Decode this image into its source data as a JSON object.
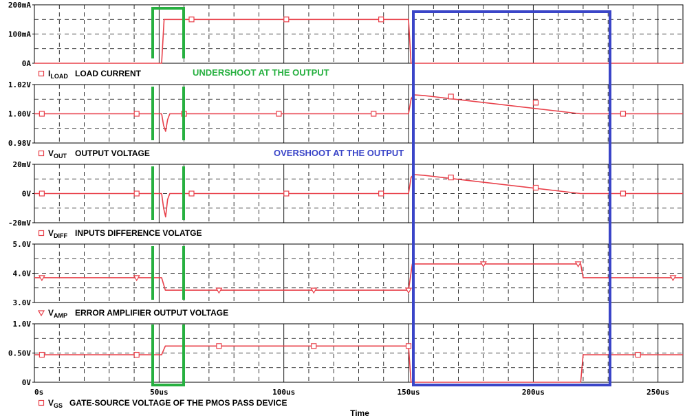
{
  "chart_data": {
    "type": "line",
    "xlabel": "Time",
    "x_ticks": [
      "0s",
      "50us",
      "100us",
      "150us",
      "200us",
      "250us"
    ],
    "xlim_us": [
      0,
      260
    ],
    "line_color": "#e8404a",
    "panels": [
      {
        "id": "iload",
        "signal": "I",
        "subscript": "LOAD",
        "description": "LOAD CURRENT",
        "marker": "square",
        "ylim": [
          0,
          0.2
        ],
        "y_ticks": [
          {
            "v": 0.2,
            "label": "200mA"
          },
          {
            "v": 0.1,
            "label": "100mA"
          },
          {
            "v": 0,
            "label": "0A"
          }
        ],
        "x": [
          0,
          51,
          52,
          150,
          151,
          260
        ],
        "y": [
          0,
          0,
          0.15,
          0.15,
          0,
          0
        ],
        "markers": [
          [
            63,
            0.15
          ],
          [
            101,
            0.15
          ],
          [
            139,
            0.15
          ]
        ]
      },
      {
        "id": "vout",
        "signal": "V",
        "subscript": "OUT",
        "description": "OUTPUT VOLTAGE",
        "marker": "square",
        "ylim": [
          0.98,
          1.02
        ],
        "y_ticks": [
          {
            "v": 1.02,
            "label": "1.02V"
          },
          {
            "v": 1.0,
            "label": "1.00V"
          },
          {
            "v": 0.98,
            "label": "0.98V"
          }
        ],
        "x": [
          0,
          51,
          51.8,
          52.6,
          53.4,
          54.3,
          150,
          151,
          152,
          156,
          219,
          260
        ],
        "y": [
          1.0,
          1.0,
          0.992,
          0.988,
          0.996,
          1.0,
          1.0,
          1.01,
          1.013,
          1.0125,
          1.0,
          1.0
        ],
        "markers": [
          [
            3,
            1.0
          ],
          [
            41,
            1.0
          ],
          [
            60,
            1.0
          ],
          [
            98,
            1.0
          ],
          [
            136,
            1.0
          ],
          [
            167,
            1.0118
          ],
          [
            201,
            1.0076
          ],
          [
            236,
            1.0
          ]
        ]
      },
      {
        "id": "vdiff",
        "signal": "V",
        "subscript": "DIFF",
        "description": "INPUTS DIFFERENCE VOLATGE",
        "marker": "square",
        "ylim": [
          -0.02,
          0.02
        ],
        "y_ticks": [
          {
            "v": 0.02,
            "label": "20mV"
          },
          {
            "v": 0,
            "label": "0V"
          },
          {
            "v": -0.02,
            "label": "-20mV"
          }
        ],
        "x": [
          0,
          51,
          51.8,
          52.6,
          53.4,
          54.3,
          150,
          151,
          152,
          156,
          219,
          260
        ],
        "y": [
          0,
          0,
          -0.01,
          -0.016,
          -0.004,
          0,
          0,
          0.011,
          0.013,
          0.0125,
          0,
          0
        ],
        "markers": [
          [
            3,
            0
          ],
          [
            41,
            0
          ],
          [
            63,
            0
          ],
          [
            101,
            0
          ],
          [
            139,
            0
          ],
          [
            167,
            0.011
          ],
          [
            201,
            0.004
          ],
          [
            236,
            0
          ]
        ]
      },
      {
        "id": "vamp",
        "signal": "V",
        "subscript": "AMP",
        "description": "ERROR AMPLIFIER OUTPUT VOLTAGE",
        "marker": "triangle",
        "ylim": [
          3.0,
          5.0
        ],
        "y_ticks": [
          {
            "v": 5.0,
            "label": "5.0V"
          },
          {
            "v": 4.0,
            "label": "4.0V"
          },
          {
            "v": 3.0,
            "label": "3.0V"
          }
        ],
        "x": [
          0,
          51,
          52.5,
          150,
          151.5,
          219,
          220,
          260
        ],
        "y": [
          3.85,
          3.85,
          3.42,
          3.42,
          4.32,
          4.32,
          3.85,
          3.85
        ],
        "markers": [
          [
            3,
            3.85
          ],
          [
            41,
            3.85
          ],
          [
            74,
            3.42
          ],
          [
            112,
            3.42
          ],
          [
            150,
            3.42
          ],
          [
            180,
            4.32
          ],
          [
            218,
            4.32
          ],
          [
            256,
            3.85
          ]
        ]
      },
      {
        "id": "vgs",
        "signal": "V",
        "subscript": "GS",
        "description": "GATE-SOURCE VOLTAGE OF THE PMOS PASS DEVICE",
        "marker": "square",
        "ylim": [
          0,
          1.0
        ],
        "y_ticks": [
          {
            "v": 1.0,
            "label": "1.0V"
          },
          {
            "v": 0.5,
            "label": "0.50V"
          },
          {
            "v": 0,
            "label": "0V"
          }
        ],
        "x": [
          0,
          51,
          52.5,
          150,
          151,
          219,
          220,
          260
        ],
        "y": [
          0.47,
          0.47,
          0.62,
          0.62,
          0.0,
          0.0,
          0.47,
          0.47
        ],
        "markers": [
          [
            3,
            0.47
          ],
          [
            41,
            0.47
          ],
          [
            74,
            0.62
          ],
          [
            112,
            0.62
          ],
          [
            150,
            0.62
          ],
          [
            242,
            0.47
          ]
        ]
      }
    ],
    "annotations": [
      {
        "text": "UNDERSHOOT AT THE OUTPUT",
        "color": "#27b040"
      },
      {
        "text": "OVERSHOOT AT THE OUTPUT",
        "color": "#3a45c8"
      }
    ]
  }
}
